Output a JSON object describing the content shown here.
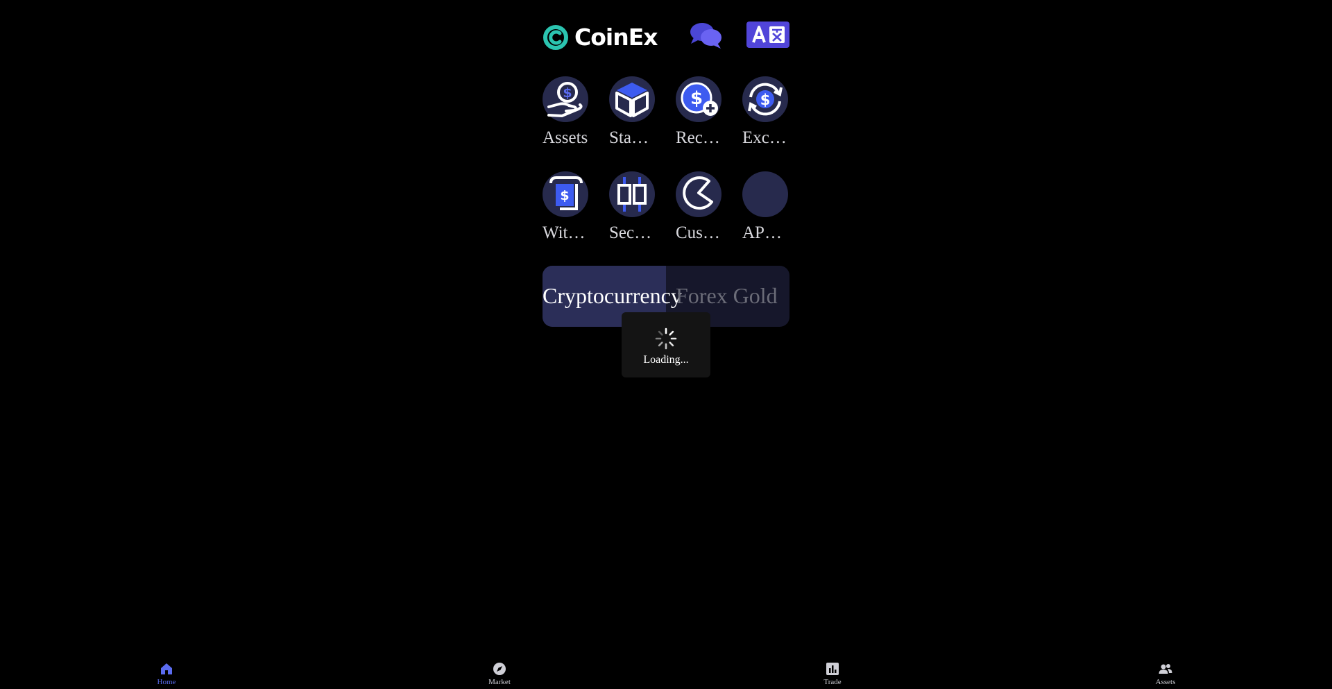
{
  "brand": {
    "name": "CoinEx",
    "accent": "#2bc4b0"
  },
  "header": {
    "chat_icon": "chat-bubbles-icon",
    "language_icon": "translate-icon"
  },
  "grid": {
    "items": [
      {
        "label": "Assets",
        "icon": "hand-dollar-icon"
      },
      {
        "label": "Sta…",
        "icon": "cube-icon"
      },
      {
        "label": "Rec…",
        "icon": "dollar-plus-icon"
      },
      {
        "label": "Exc…",
        "icon": "exchange-dollar-icon"
      },
      {
        "label": "Wit…",
        "icon": "withdraw-icon"
      },
      {
        "label": "Sec…",
        "icon": "candlestick-icon"
      },
      {
        "label": "Cus…",
        "icon": "pie-icon"
      },
      {
        "label": "AP…",
        "icon": "app-icon"
      }
    ]
  },
  "tabs": {
    "crypto": "Cryptocurrency",
    "forex": "Forex Gold"
  },
  "loading": {
    "text": "Loading..."
  },
  "nav": {
    "home": "Home",
    "market": "Market",
    "trade": "Trade",
    "assets": "Assets",
    "active_color": "#5b6cf0"
  }
}
